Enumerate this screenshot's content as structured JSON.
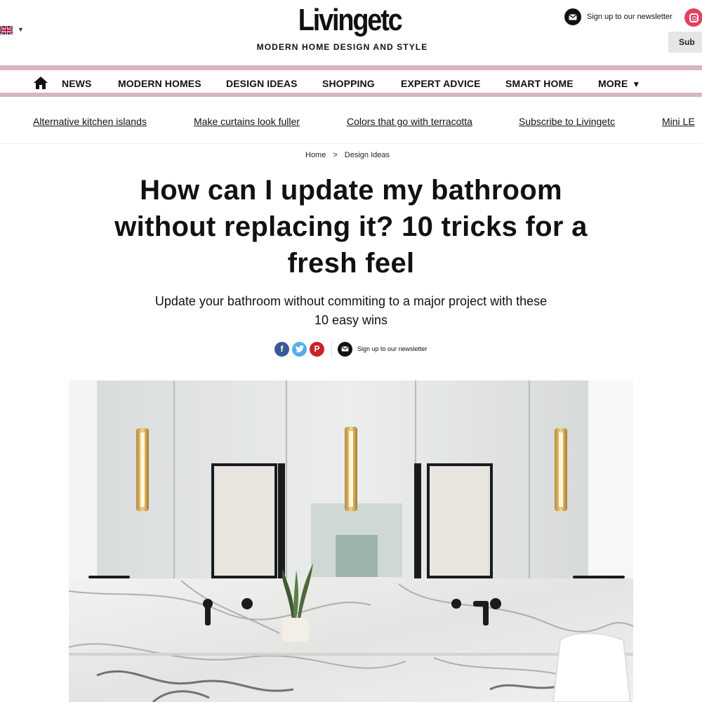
{
  "site": {
    "logo_text": "Livingetc",
    "tagline": "MODERN HOME DESIGN AND STYLE",
    "newsletter_label": "Sign up to our newsletter",
    "subscribe_label": "Sub",
    "region_flag": "uk-flag-icon"
  },
  "nav": {
    "home_icon": "home-icon",
    "items": [
      "NEWS",
      "MODERN HOMES",
      "DESIGN IDEAS",
      "SHOPPING",
      "EXPERT ADVICE",
      "SMART HOME",
      "MORE"
    ],
    "stripe_color": "#d9b5bd"
  },
  "trending": {
    "links": [
      "Alternative kitchen islands",
      "Make curtains look fuller",
      "Colors that go with terracotta",
      "Subscribe to Livingetc",
      "Mini LE"
    ]
  },
  "breadcrumb": {
    "home": "Home",
    "separator": ">",
    "current": "Design Ideas"
  },
  "article": {
    "headline": "How can I update my bathroom without replacing it? 10 tricks for a fresh feel",
    "standfirst": "Update your bathroom without commiting to a major project with these 10 easy wins",
    "share_icons": [
      "facebook-icon",
      "twitter-icon",
      "pinterest-icon"
    ],
    "newsletter_label": "Sign up to our newsletter"
  },
  "hero": {
    "subject": "marble double vanity bathroom with brass wall lights and mirrored cabinets"
  },
  "colors": {
    "accent_pink": "#d9b5bd",
    "facebook": "#3b5998",
    "twitter": "#55acee",
    "pinterest": "#cb2027",
    "instagram": "#e4405f"
  }
}
